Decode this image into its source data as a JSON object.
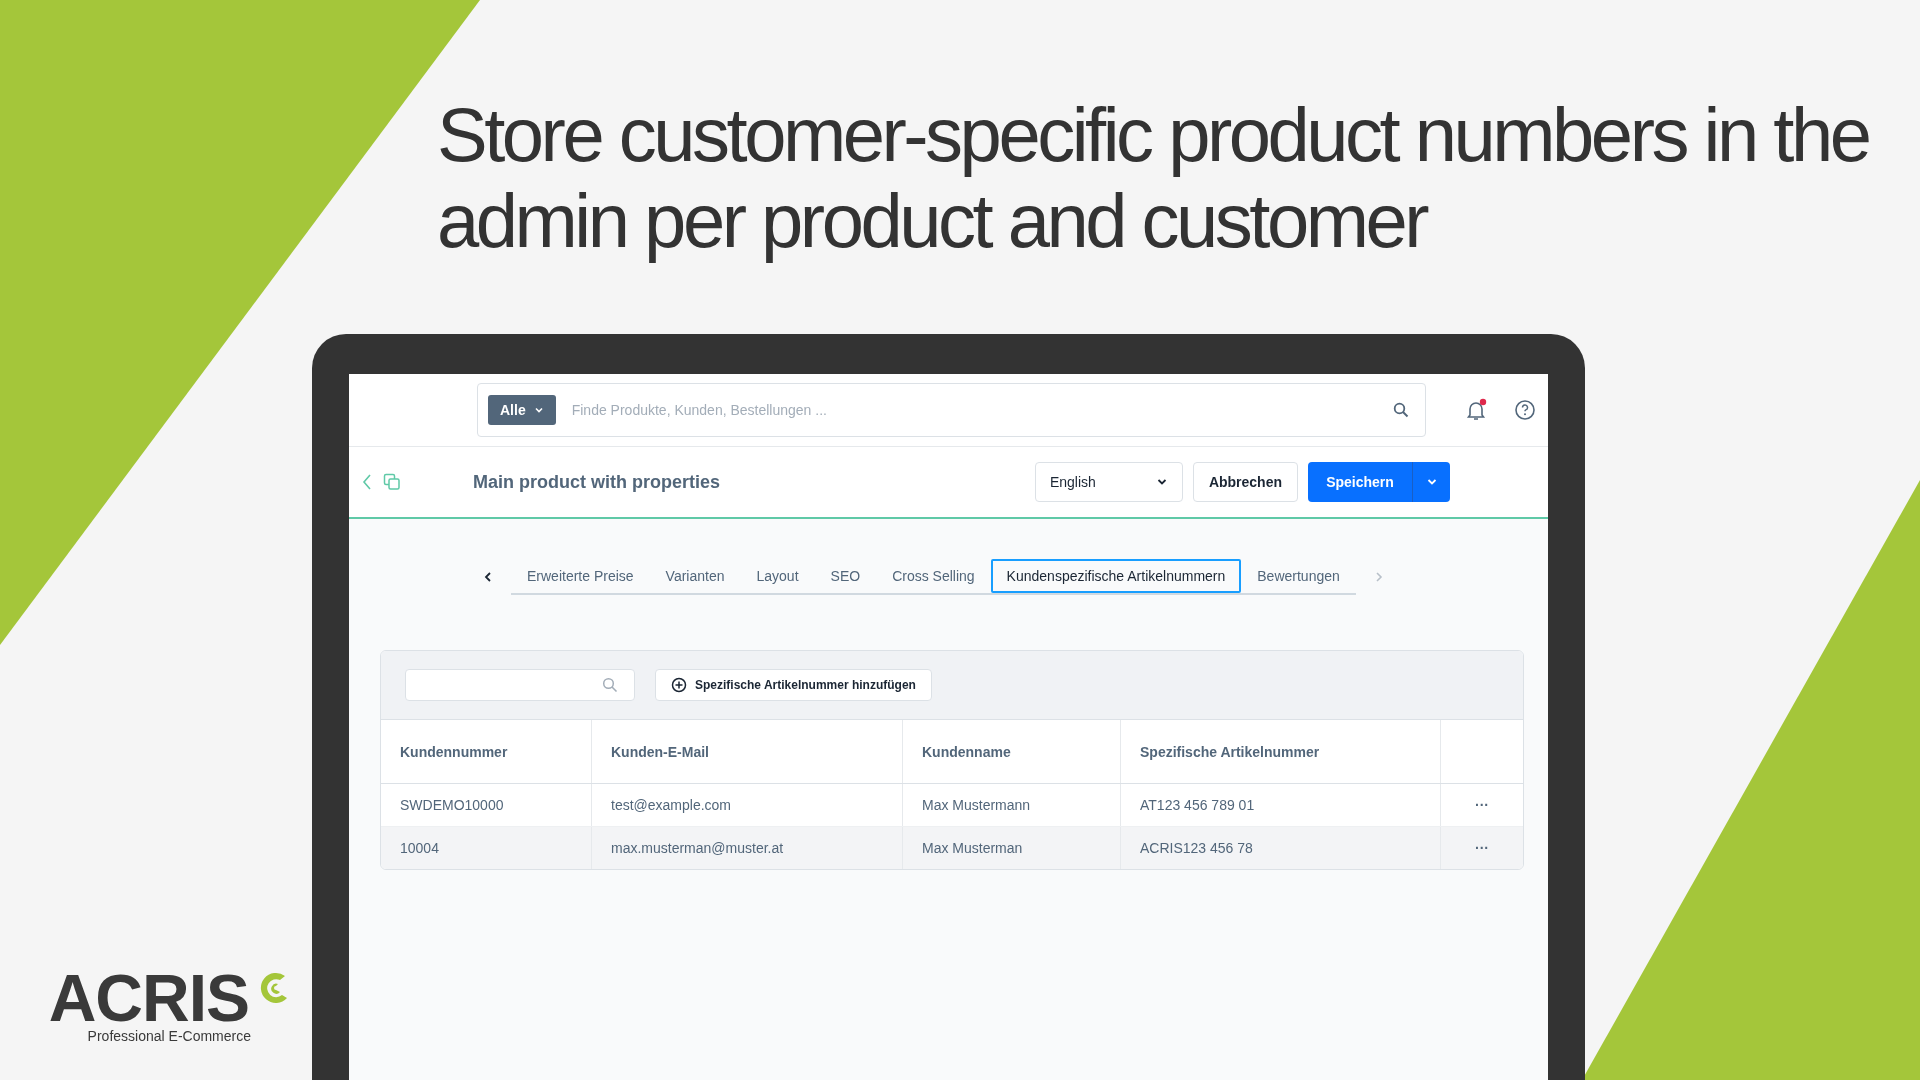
{
  "headline": "Store customer-specific product numbers in the admin per product and customer",
  "topbar": {
    "search_scope": "Alle",
    "search_placeholder": "Finde Produkte, Kunden, Bestellungen ...",
    "notification": true
  },
  "header": {
    "title": "Main product with properties",
    "language": "English",
    "cancel": "Abbrechen",
    "save": "Speichern"
  },
  "tabs": [
    {
      "label": "Erweiterte Preise",
      "selected": false
    },
    {
      "label": "Varianten",
      "selected": false
    },
    {
      "label": "Layout",
      "selected": false
    },
    {
      "label": "SEO",
      "selected": false
    },
    {
      "label": "Cross Selling",
      "selected": false
    },
    {
      "label": "Kundenspezifische Artikelnummern",
      "selected": true
    },
    {
      "label": "Bewertungen",
      "selected": false
    }
  ],
  "toolbar": {
    "add_button": "Spezifische Artikelnummer hinzufügen"
  },
  "table": {
    "columns": [
      "Kundennummer",
      "Kunden-E-Mail",
      "Kundenname",
      "Spezifische Artikelnummer"
    ],
    "rows": [
      [
        "SWDEMO10000",
        "test@example.com",
        "Max Mustermann",
        "AT123 456 789 01"
      ],
      [
        "10004",
        "max.musterman@muster.at",
        "Max Musterman",
        "ACRIS123 456 78"
      ]
    ],
    "row_action": "···"
  },
  "logo": {
    "name": "ACRIS",
    "tagline": "Professional E-Commerce"
  }
}
